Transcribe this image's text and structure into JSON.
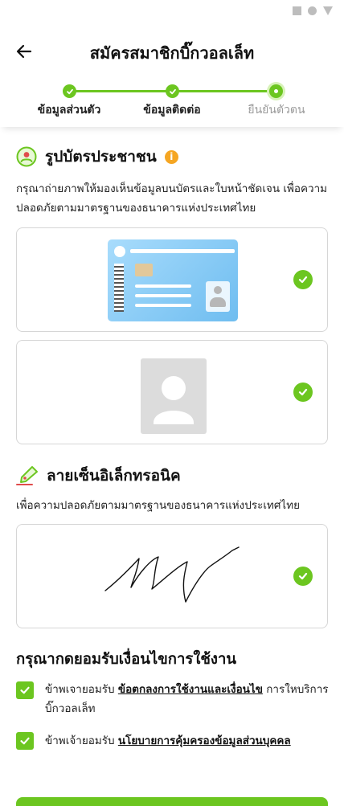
{
  "status_bar": {
    "icons": [
      "square-icon",
      "circle-icon",
      "triangle-icon"
    ]
  },
  "header": {
    "title": "สมัครสมาชิกบิ๊กวอลเล็ท",
    "back_icon": "arrow-left-icon"
  },
  "stepper": {
    "steps": [
      {
        "label": "ข้อมูลส่วนตัว",
        "state": "done"
      },
      {
        "label": "ข้อมูลติดต่อ",
        "state": "done"
      },
      {
        "label": "ยืนยันตัวตน",
        "state": "current"
      }
    ],
    "accent": "#6cc620"
  },
  "id_section": {
    "title": "รูปบัตรประชาชน",
    "info_icon": "info-icon",
    "info_glyph": "i",
    "description": "กรุณาถ่ายภาพให้มองเห็นข้อมูลบนบัตรและใบหน้าชัดเจน เพื่อความปลอดภัยตามมาตรฐานของธนาคารแห่งประเทศไทย",
    "cards": [
      {
        "image": "id-card-image",
        "verified": true
      },
      {
        "image": "portrait-placeholder-image",
        "verified": true
      }
    ]
  },
  "signature_section": {
    "title": "ลายเซ็นอิเล็กทรอนิค",
    "description": "เพื่อความปลอดภัยตามมาตรฐานของธนาคารแห่งประเทศไทย",
    "verified": true
  },
  "terms": {
    "title": "กรุณากดยอมรับเงื่อนไขการใช้งาน",
    "items": [
      {
        "checked": true,
        "prefix": "ข้าพเจายอมรับ ",
        "link": "ข้อตกลงการใช้งานและเงื่อนไข",
        "suffix": " การใหบริการบิ๊กวอลเล็ท"
      },
      {
        "checked": true,
        "prefix": "ข้าพเจ้ายอมรับ ",
        "link": "นโยบายการคุ้มครองข้อมูลส่วนบุคคล",
        "suffix": ""
      }
    ]
  },
  "colors": {
    "accent": "#6cc620",
    "info": "#f5a623",
    "id_card": "#8ccdf6"
  }
}
